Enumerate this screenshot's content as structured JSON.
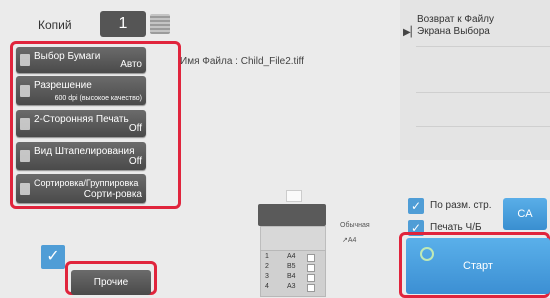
{
  "header": {
    "copies_label": "Копий",
    "copies_value": "1",
    "file_name": "Имя Файла : Child_File2.tiff"
  },
  "settings": [
    {
      "label": "Выбор Бумаги",
      "value": "Авто"
    },
    {
      "label": "Разрешение",
      "value": "600 dpi (высокое качество)"
    },
    {
      "label": "2-Сторонняя Печать",
      "value": "Off"
    },
    {
      "label": "Вид Штапелирования",
      "value": "Off"
    },
    {
      "label": "Сортировка/Группировка",
      "value": "Сорти-ровка"
    }
  ],
  "right_panel": {
    "return_line1": "Возврат к Файлу",
    "return_line2": "Экрана Выбора",
    "fit_to_page_label": "По разм. стр.",
    "print_bw_label": "Печать Ч/Б",
    "ca_label": "CA",
    "start_label": "Старт"
  },
  "bottom": {
    "more_label": "Прочие"
  },
  "machine": {
    "paper_type": "Обычная",
    "paper_size": "A4",
    "trays": [
      {
        "num": "1",
        "size": "A4"
      },
      {
        "num": "2",
        "size": "B5"
      },
      {
        "num": "3",
        "size": "B4"
      },
      {
        "num": "4",
        "size": "A3"
      }
    ]
  },
  "colors": {
    "highlight": "#e0243c",
    "accent_blue": "#4f9dd6",
    "button_dark": "#555555"
  }
}
